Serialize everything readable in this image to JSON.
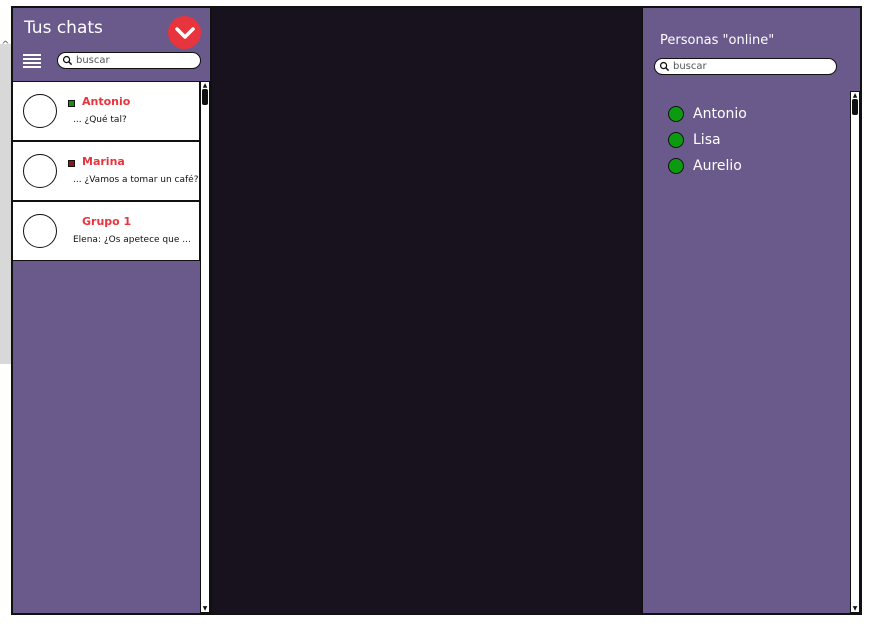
{
  "sidebar": {
    "title": "Tus chats",
    "search_placeholder": "buscar",
    "chats": [
      {
        "name": "Antonio",
        "preview": "... ¿Qué tal?",
        "status_color": "#1a8a1a"
      },
      {
        "name": "Marina",
        "preview": "... ¿Vamos a tomar un café?",
        "status_color": "#8a1a1a"
      },
      {
        "name": "Grupo 1",
        "preview": "Elena: ¿Os apetece que ..."
      }
    ]
  },
  "online_panel": {
    "title": "Personas \"online\"",
    "search_placeholder": "buscar",
    "people": [
      {
        "name": "Antonio"
      },
      {
        "name": "Lisa"
      },
      {
        "name": "Aurelio"
      }
    ]
  },
  "icons": {
    "logo": "chevron-down-logo-icon",
    "menu": "hamburger-menu-icon",
    "search": "search-icon",
    "online": "online-status-icon"
  },
  "colors": {
    "panel": "#6a5a8c",
    "chat_bg": "#17121d",
    "accent": "#e8343c",
    "online": "#0c9a10"
  }
}
